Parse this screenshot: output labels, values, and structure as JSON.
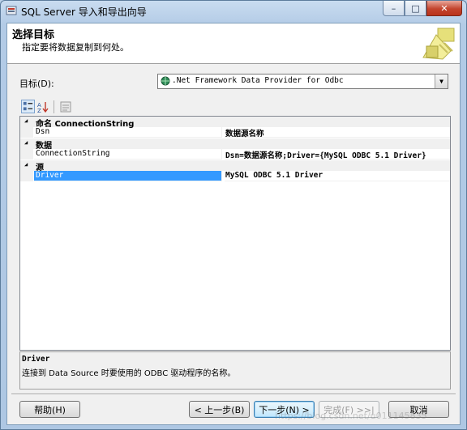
{
  "window": {
    "title": "SQL Server 导入和导出向导",
    "caption_buttons": {
      "minimize": "–",
      "maximize": "□",
      "close": "✕"
    }
  },
  "header": {
    "title": "选择目标",
    "subtitle": "指定要将数据复制到何处。"
  },
  "destination": {
    "label": "目标(D):",
    "selected": ".Net Framework Data Provider for Odbc"
  },
  "toolbar": {
    "icons": [
      "categorized-icon",
      "alphabetical-icon",
      "property-pages-icon"
    ]
  },
  "property_grid": {
    "categories": [
      {
        "label": "命名 ConnectionString",
        "properties": [
          {
            "name": "Dsn",
            "value": "数据源名称"
          }
        ]
      },
      {
        "label": "数据",
        "properties": [
          {
            "name": "ConnectionString",
            "value": "Dsn=数据源名称;Driver={MySQL ODBC 5.1 Driver}"
          }
        ]
      },
      {
        "label": "源",
        "properties": [
          {
            "name": "Driver",
            "value": "MySQL ODBC 5.1 Driver",
            "selected": true
          }
        ]
      }
    ]
  },
  "description": {
    "title": "Driver",
    "text": "连接到 Data Source 时要使用的 ODBC 驱动程序的名称。"
  },
  "buttons": {
    "help": "帮助(H)",
    "back": "< 上一步(B)",
    "next": "下一步(N) >",
    "finish": "完成(F) >>|",
    "cancel": "取消"
  },
  "watermark": "https://blog.csdn.net/u011145835",
  "colors": {
    "selection": "#3399ff",
    "close_button": "#c3442d"
  }
}
